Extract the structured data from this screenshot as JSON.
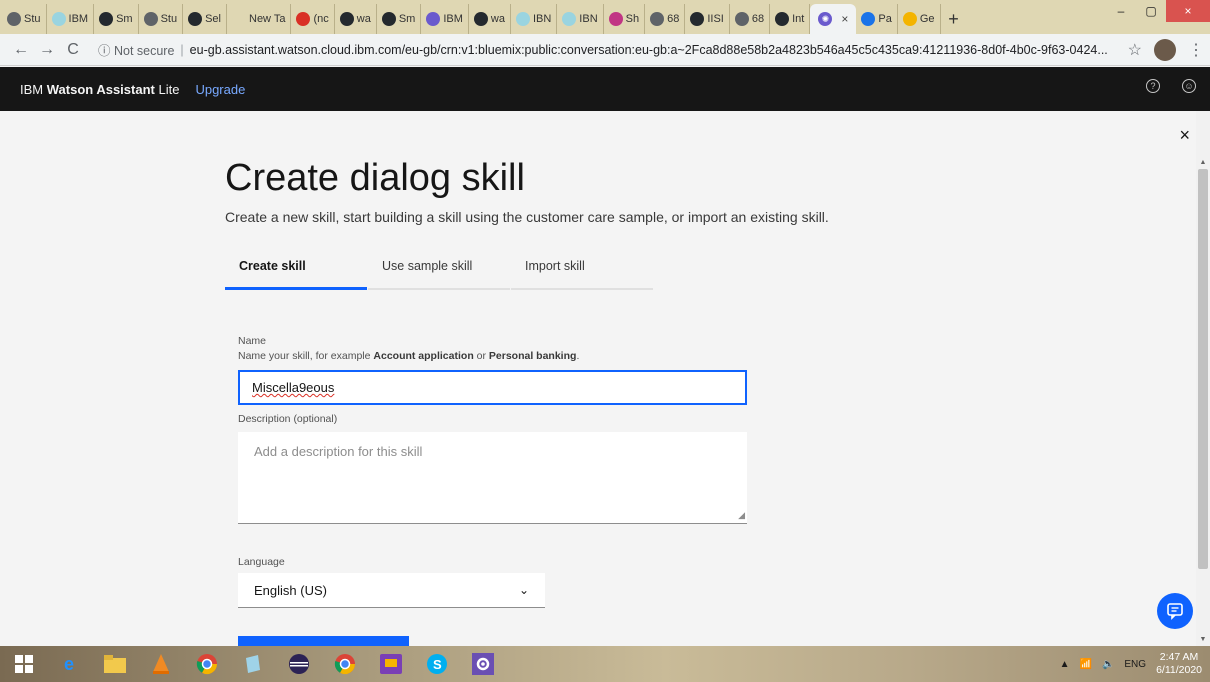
{
  "browser": {
    "tabs": [
      {
        "label": "Stu",
        "color": "#5f6368"
      },
      {
        "label": "IBM",
        "color": "#9ad4e0"
      },
      {
        "label": "Sm",
        "color": "#24292e"
      },
      {
        "label": "Stu",
        "color": "#5f6368"
      },
      {
        "label": "Sel",
        "color": "#24292e"
      },
      {
        "label": "New Ta",
        "color": "#dfd7b3"
      },
      {
        "label": "(nc",
        "color": "#d93025"
      },
      {
        "label": "wa",
        "color": "#24292e"
      },
      {
        "label": "Sm",
        "color": "#24292e"
      },
      {
        "label": "IBM",
        "color": "#6a5acd"
      },
      {
        "label": "wa",
        "color": "#24292e"
      },
      {
        "label": "IBN",
        "color": "#9ad4e0"
      },
      {
        "label": "IBN",
        "color": "#9ad4e0"
      },
      {
        "label": "Sh",
        "color": "#c13584"
      },
      {
        "label": "68",
        "color": "#5f6368"
      },
      {
        "label": "IISI",
        "color": "#24292e"
      },
      {
        "label": "68",
        "color": "#5f6368"
      },
      {
        "label": "Int",
        "color": "#24292e"
      }
    ],
    "active_tab_close": "×",
    "trailing_tabs": [
      {
        "label": "Pa",
        "color": "#1a73e8"
      },
      {
        "label": "Ge",
        "color": "#f4b400"
      }
    ],
    "new_tab_label": "+",
    "window_controls": {
      "minimize": "–",
      "maximize": "▢",
      "close": "×"
    },
    "nav": {
      "back": "←",
      "forward": "→",
      "reload": "C"
    },
    "security_label": "ⓘ Not secure",
    "url": "eu-gb.assistant.watson.cloud.ibm.com/eu-gb/crn:v1:bluemix:public:conversation:eu-gb:a~2Fca8d88e58b2a4823b546a45c5c435ca9:41211936-8d0f-4b0c-9f63-0424...",
    "bookmark_star": "☆",
    "menu_kebab": "⋮"
  },
  "ibm_bar": {
    "brand_prefix": "IBM",
    "brand_bold": "Watson Assistant",
    "brand_suffix": "Lite",
    "upgrade": "Upgrade",
    "help_icon": "?",
    "user_icon": "☺"
  },
  "page": {
    "close": "×",
    "title": "Create dialog skill",
    "subtitle": "Create a new skill, start building a skill using the customer care sample, or import an existing skill.",
    "tabs": [
      {
        "label": "Create skill",
        "selected": true
      },
      {
        "label": "Use sample skill",
        "selected": false
      },
      {
        "label": "Import skill",
        "selected": false
      }
    ],
    "name": {
      "label": "Name",
      "hint_prefix": "Name your skill, for example ",
      "hint_ex1": "Account application",
      "hint_mid": " or ",
      "hint_ex2": "Personal banking",
      "hint_suffix": ".",
      "value": "Miscella9eous"
    },
    "description": {
      "label": "Description (optional)",
      "placeholder": "Add a description for this skill"
    },
    "language": {
      "label": "Language",
      "selected": "English (US)"
    },
    "chat_icon": "💬"
  },
  "taskbar": {
    "tray_lang": "ENG",
    "time": "2:47 AM",
    "date": "6/11/2020"
  }
}
